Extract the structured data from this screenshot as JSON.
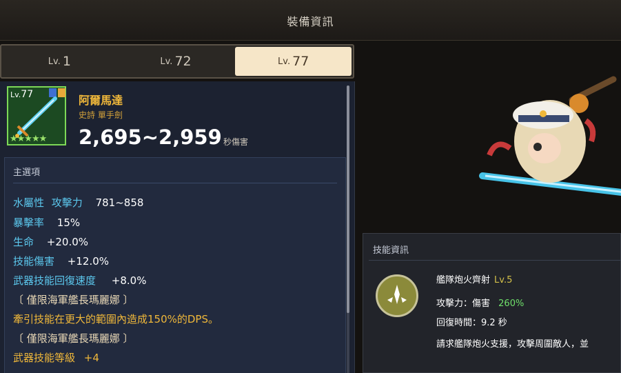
{
  "header": {
    "title": "裝備資訊"
  },
  "tabs": [
    {
      "prefix": "Lv.",
      "number": "1",
      "active": false
    },
    {
      "prefix": "Lv.",
      "number": "72",
      "active": false
    },
    {
      "prefix": "Lv.",
      "number": "77",
      "active": true
    }
  ],
  "item": {
    "level_prefix": "Lv.",
    "level": "77",
    "stars": "★★★★★",
    "name": "阿爾馬達",
    "rarity": "史詩  單手劍",
    "dps": "2,695~2,959",
    "dps_label": "秒傷害"
  },
  "options": {
    "heading": "主選項",
    "row1_a": "水屬性",
    "row1_b": "攻擊力",
    "row1_val": "781~858",
    "row2_label": "暴擊率",
    "row2_val": "15%",
    "row3_label": "生命",
    "row3_val": "+20.0%",
    "row4_label": "技能傷害",
    "row4_val": "+12.0%",
    "row5_label": "武器技能回復速度",
    "row5_val": "+8.0%",
    "exclusive1": "〔 僅限海軍艦長瑪麗娜 〕",
    "exclusive1_desc": "牽引技能在更大的範圍內造成150%的DPS。",
    "exclusive2": "〔 僅限海軍艦長瑪麗娜 〕",
    "row6_label": "武器技能等級",
    "row6_val": "+4"
  },
  "skill": {
    "heading": "技能資訊",
    "name": "艦隊炮火齊射",
    "level": "Lv.5",
    "attack_label": "攻擊力：傷害",
    "attack_val": "260%",
    "cooldown": "回復時間：9.2 秒",
    "desc": "請求艦隊炮火支援，攻擊周圍敵人，並"
  },
  "colors": {
    "accent_gold": "#f0b83a",
    "option_cyan": "#5cc8ee",
    "active_tab": "#f6e6c8",
    "grade_green": "#7ed957"
  }
}
